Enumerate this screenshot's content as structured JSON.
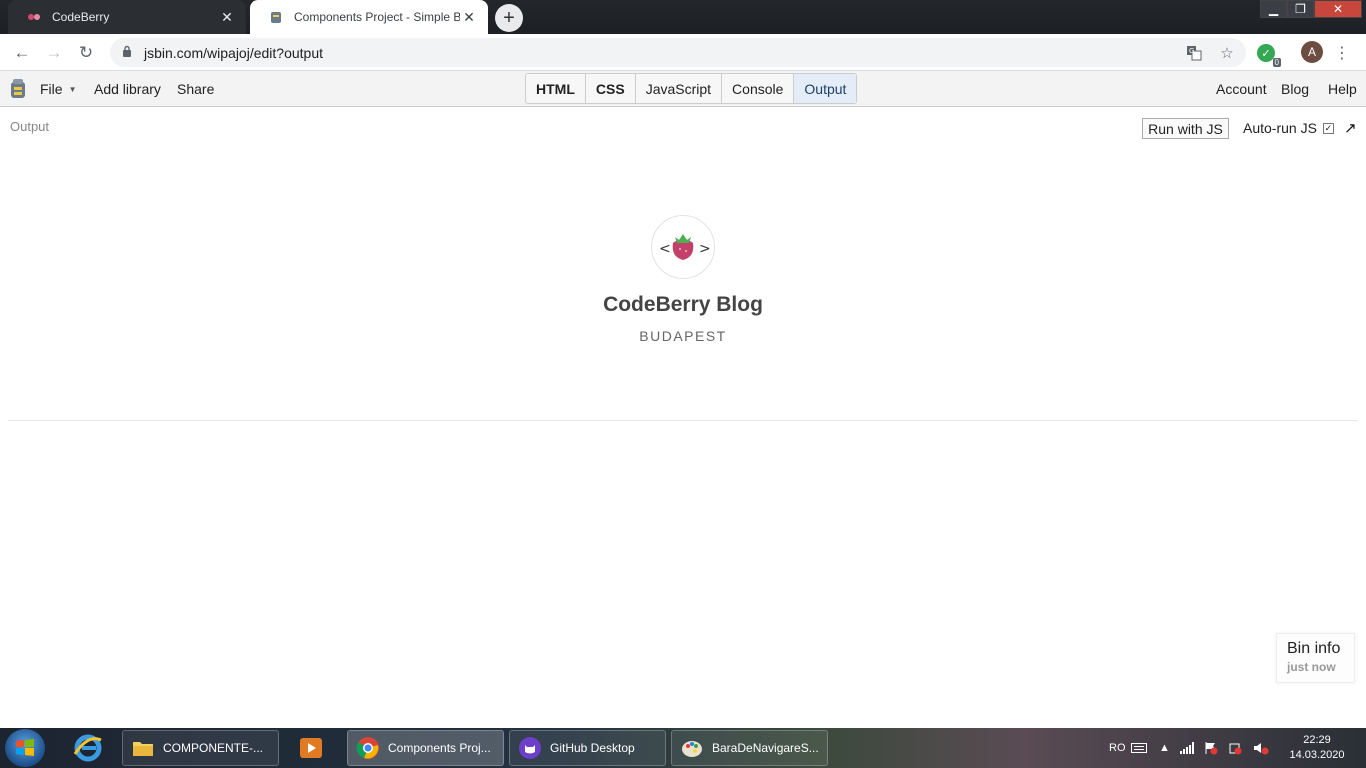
{
  "browser": {
    "tabs": [
      {
        "title": "CodeBerry",
        "active": false
      },
      {
        "title": "Components Project - Simple Blo",
        "active": true
      }
    ],
    "url": "jsbin.com/wipajoj/edit?output",
    "extension_badge_count": "0",
    "avatar_letter": "A"
  },
  "jsbin": {
    "menu": {
      "file": "File",
      "add_library": "Add library",
      "share": "Share"
    },
    "panels": [
      "HTML",
      "CSS",
      "JavaScript",
      "Console",
      "Output"
    ],
    "active_panel": "Output",
    "right_menu": {
      "account": "Account",
      "blog": "Blog",
      "help": "Help"
    },
    "output_label": "Output",
    "run_button": "Run with JS",
    "autorun_label": "Auto-run JS",
    "autorun_checked": true,
    "popout_icon": "↗",
    "bin_info": {
      "title": "Bin info",
      "subtitle": "just now"
    }
  },
  "page": {
    "logo_left_bracket": "<",
    "logo_right_bracket": ">",
    "title": "CodeBerry Blog",
    "subtitle": "BUDAPEST"
  },
  "taskbar": {
    "tasks": [
      {
        "label": "COMPONENTE-...",
        "icon": "folder-icon"
      },
      {
        "label": "Components Proj...",
        "icon": "chrome-icon"
      },
      {
        "label": "GitHub Desktop",
        "icon": "github-icon"
      },
      {
        "label": "BaraDeNavigareS...",
        "icon": "paint-icon"
      }
    ],
    "language": "RO",
    "time": "22:29",
    "date": "14.03.2020"
  },
  "colors": {
    "active_panel_bg": "#e4edf7",
    "berry": "#c2406a",
    "chrome_dark": "#202124"
  }
}
